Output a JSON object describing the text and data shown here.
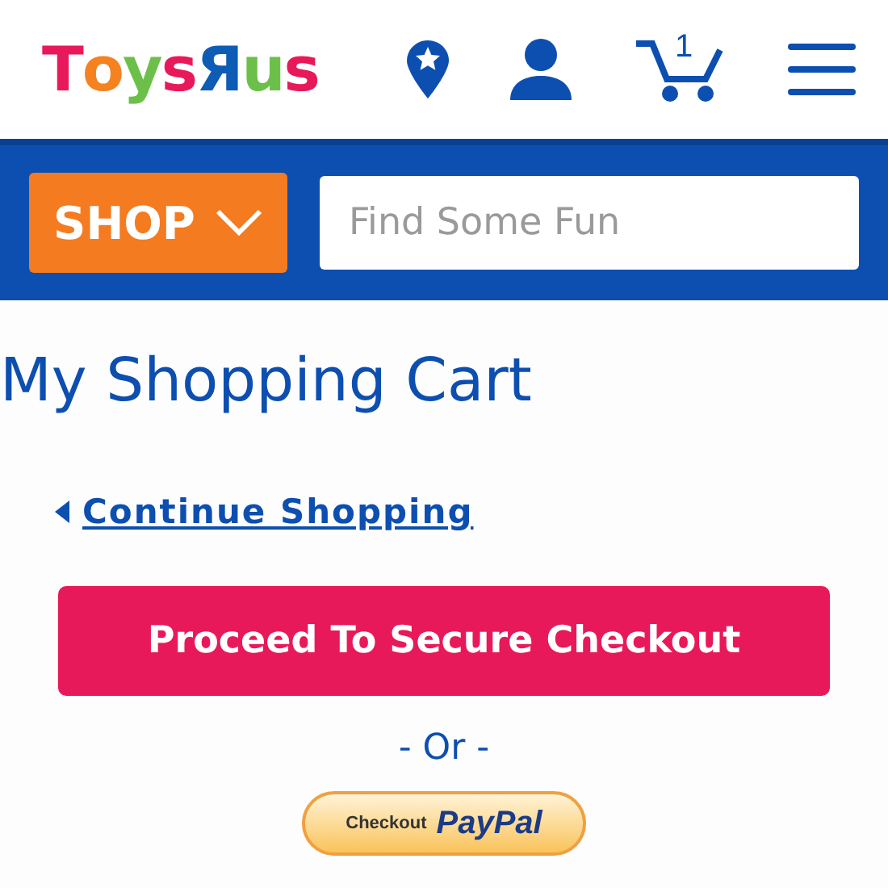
{
  "logo": {
    "letters": [
      {
        "char": "T",
        "color": "#e8195a"
      },
      {
        "char": "o",
        "color": "#f58220"
      },
      {
        "char": "y",
        "color": "#6cc04a"
      },
      {
        "char": "s",
        "color": "#e8195a"
      },
      {
        "char": "Я",
        "color": "#0d5cb6"
      },
      {
        "char": "u",
        "color": "#6cc04a"
      },
      {
        "char": "s",
        "color": "#e8195a"
      }
    ]
  },
  "header": {
    "cart_count": "1"
  },
  "search_bar": {
    "shop_button": "SHOP",
    "placeholder": "Find Some Fun"
  },
  "title": "My Shopping Cart",
  "continue_link": "Continue Shopping",
  "checkout_button": "Proceed To Secure Checkout",
  "separator": "- Or -",
  "paypal_button": {
    "prefix": "Checkout",
    "brand": "PayPal"
  }
}
